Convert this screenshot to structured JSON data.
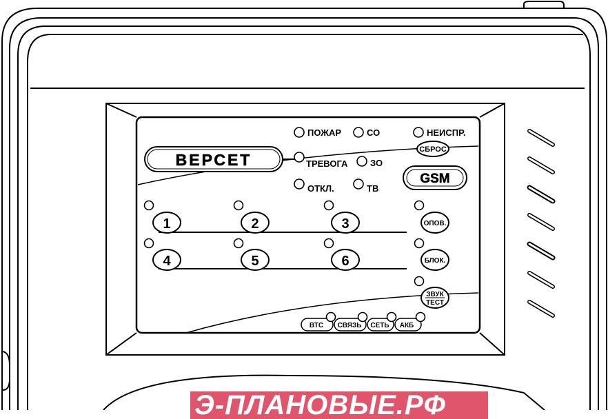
{
  "brand": "ВЕРСЕТ",
  "indicators": {
    "fire": "ПОЖАР",
    "co": "СО",
    "fault": "НЕИСПР.",
    "alarm": "ТРЕВОГА",
    "zo": "ЗО",
    "off": "ОТКЛ.",
    "tv": "ТВ"
  },
  "buttons": {
    "reset": "СБРОС",
    "gsm": "GSM",
    "notify": "ОПОВ.",
    "block": "БЛОК.",
    "sound_line1": "ЗВУК",
    "sound_line2": "ТЕСТ"
  },
  "zones": [
    "1",
    "2",
    "3",
    "4",
    "5",
    "6"
  ],
  "status": {
    "btc": "ВТС",
    "link": "СВЯЗЬ",
    "net": "СЕТЬ",
    "battery": "АКБ"
  },
  "watermark": "Э-ПЛАНОВЫЕ.РФ",
  "colors": {
    "stroke": "#000000",
    "watermark_bg": "#e0556b"
  }
}
